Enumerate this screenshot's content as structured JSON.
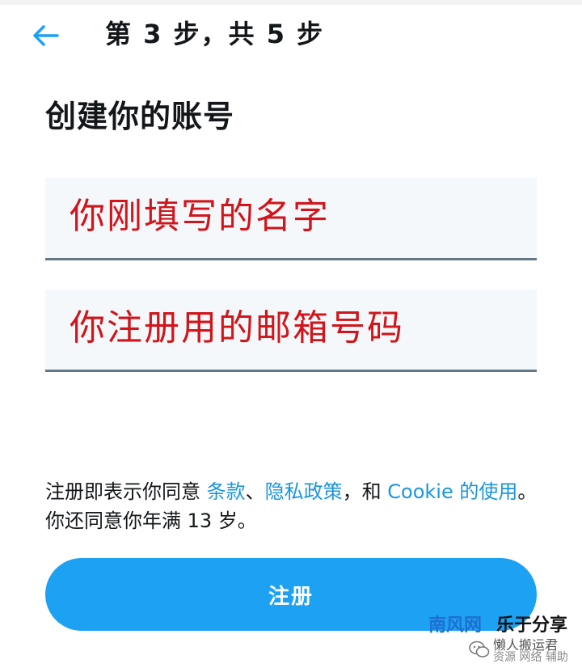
{
  "header": {
    "back_icon": "arrow-left-icon",
    "step_text": "第 3 步，共 5 步",
    "accent_color": "#1da1f2"
  },
  "page": {
    "title": "创建你的账号"
  },
  "fields": {
    "name_value": "你刚填写的名字",
    "email_value": "你注册用的邮箱号码",
    "annotation_color": "#d0151b"
  },
  "legal": {
    "text_1": "注册即表示你同意 ",
    "terms_link": "条款",
    "sep_1": "、",
    "privacy_link": "隐私政策",
    "sep_2": "，和 ",
    "cookie_link": "Cookie 的使用",
    "text_2": "。你还同意你年满 13 岁。"
  },
  "signup": {
    "label": "注册"
  },
  "watermark": {
    "brand_1": "南风网",
    "brand_2": "乐于分享",
    "sub_1": "懒人搬运君",
    "sub_2": "资源 网络 辅助",
    "logo_icon": "wechat-logo-icon"
  }
}
